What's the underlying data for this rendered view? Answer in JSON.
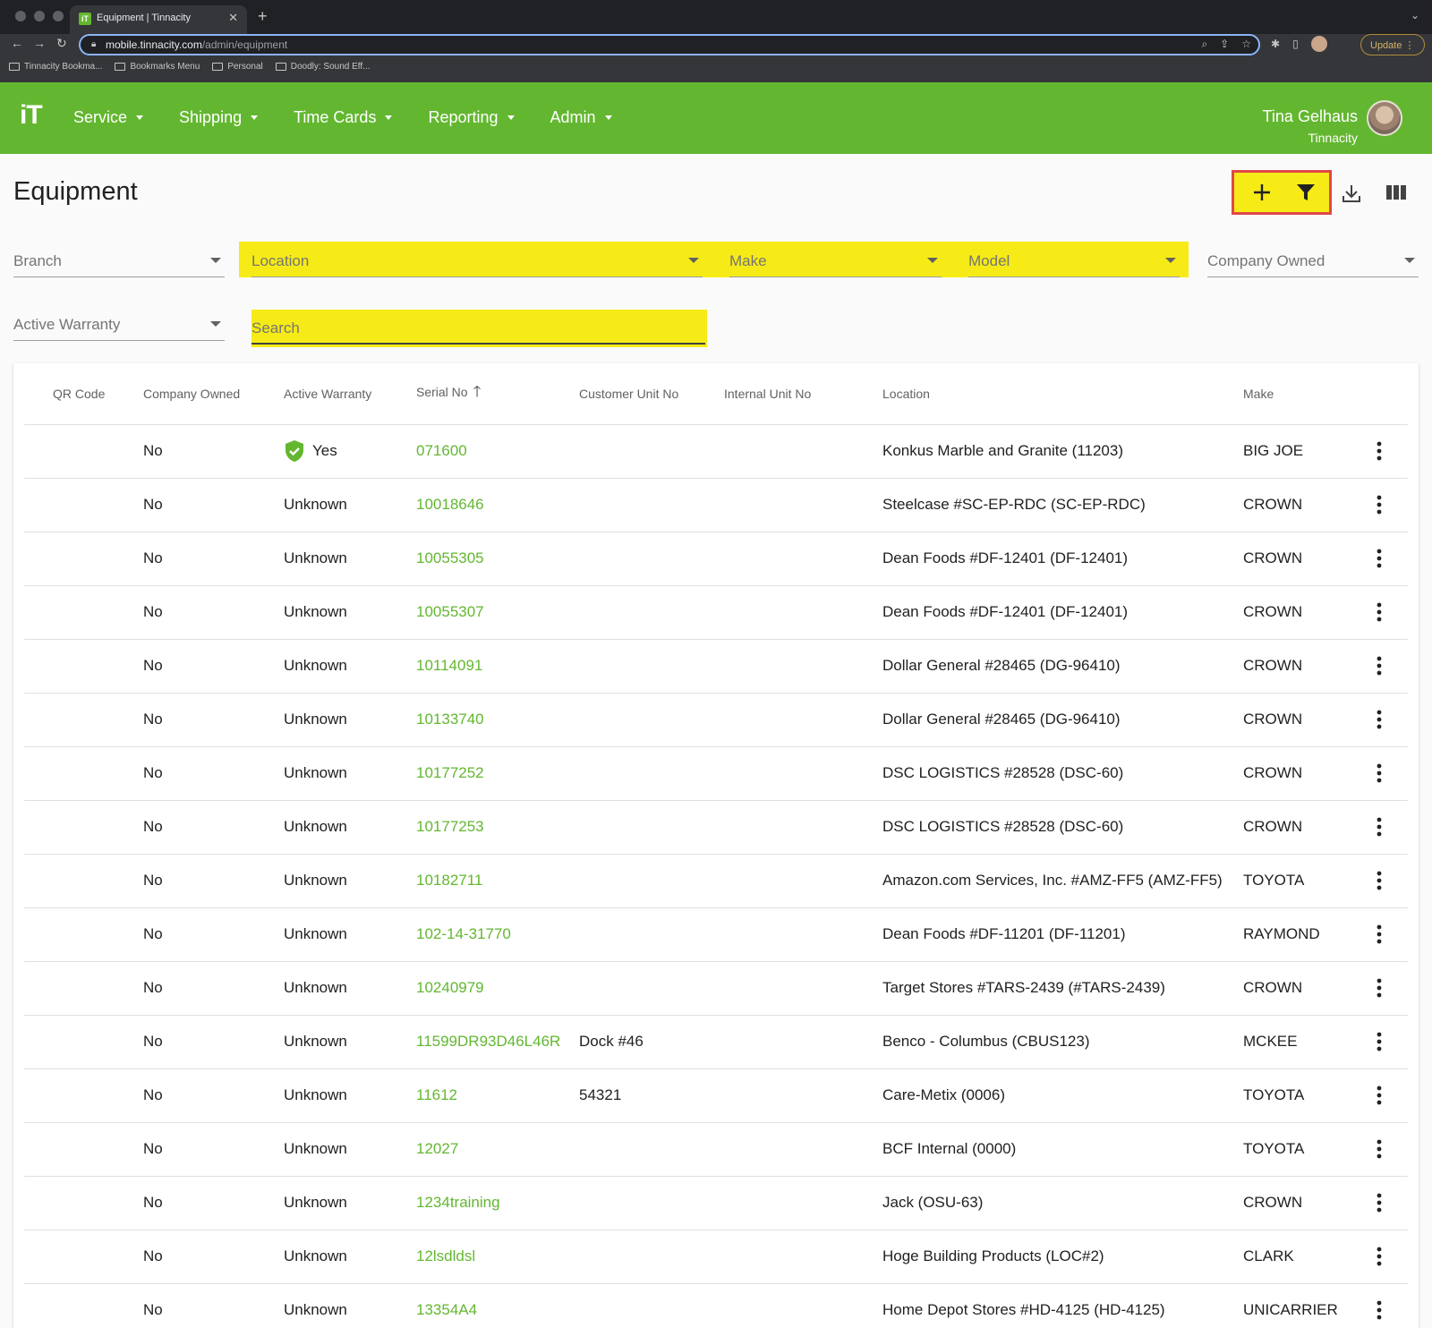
{
  "browser": {
    "tab_title": "Equipment | Tinnacity",
    "url_host": "mobile.tinnacity.com",
    "url_path": "/admin/equipment",
    "update_label": "Update",
    "bookmarks": [
      "Tinnacity Bookma...",
      "Bookmarks Menu",
      "Personal",
      "Doodly: Sound Eff..."
    ]
  },
  "appbar": {
    "logo": "iT",
    "menu": [
      "Service",
      "Shipping",
      "Time Cards",
      "Reporting",
      "Admin"
    ],
    "user_name": "Tina Gelhaus",
    "user_org": "Tinnacity"
  },
  "page": {
    "title": "Equipment"
  },
  "filters": {
    "branch": "Branch",
    "location": "Location",
    "make": "Make",
    "model": "Model",
    "company_owned": "Company Owned",
    "active_warranty": "Active Warranty",
    "search_placeholder": "Search"
  },
  "table": {
    "columns": [
      "QR Code",
      "Company Owned",
      "Active Warranty",
      "Serial No",
      "Customer Unit No",
      "Internal Unit No",
      "Location",
      "Make"
    ],
    "rows": [
      {
        "qr": "",
        "owned": "No",
        "warranty": "Yes",
        "serial": "071600",
        "cust": "",
        "internal": "",
        "location": "Konkus Marble and Granite (11203)",
        "make": "BIG JOE"
      },
      {
        "qr": "",
        "owned": "No",
        "warranty": "Unknown",
        "serial": "10018646",
        "cust": "",
        "internal": "",
        "location": "Steelcase #SC-EP-RDC (SC-EP-RDC)",
        "make": "CROWN"
      },
      {
        "qr": "",
        "owned": "No",
        "warranty": "Unknown",
        "serial": "10055305",
        "cust": "",
        "internal": "",
        "location": "Dean Foods #DF-12401 (DF-12401)",
        "make": "CROWN"
      },
      {
        "qr": "",
        "owned": "No",
        "warranty": "Unknown",
        "serial": "10055307",
        "cust": "",
        "internal": "",
        "location": "Dean Foods #DF-12401 (DF-12401)",
        "make": "CROWN"
      },
      {
        "qr": "",
        "owned": "No",
        "warranty": "Unknown",
        "serial": "10114091",
        "cust": "",
        "internal": "",
        "location": "Dollar General #28465 (DG-96410)",
        "make": "CROWN"
      },
      {
        "qr": "",
        "owned": "No",
        "warranty": "Unknown",
        "serial": "10133740",
        "cust": "",
        "internal": "",
        "location": "Dollar General #28465 (DG-96410)",
        "make": "CROWN"
      },
      {
        "qr": "",
        "owned": "No",
        "warranty": "Unknown",
        "serial": "10177252",
        "cust": "",
        "internal": "",
        "location": "DSC LOGISTICS #28528 (DSC-60)",
        "make": "CROWN"
      },
      {
        "qr": "",
        "owned": "No",
        "warranty": "Unknown",
        "serial": "10177253",
        "cust": "",
        "internal": "",
        "location": "DSC LOGISTICS #28528 (DSC-60)",
        "make": "CROWN"
      },
      {
        "qr": "",
        "owned": "No",
        "warranty": "Unknown",
        "serial": "10182711",
        "cust": "",
        "internal": "",
        "location": "Amazon.com Services, Inc. #AMZ-FF5 (AMZ-FF5)",
        "make": "TOYOTA"
      },
      {
        "qr": "",
        "owned": "No",
        "warranty": "Unknown",
        "serial": "102-14-31770",
        "cust": "",
        "internal": "",
        "location": "Dean Foods #DF-11201 (DF-11201)",
        "make": "RAYMOND"
      },
      {
        "qr": "",
        "owned": "No",
        "warranty": "Unknown",
        "serial": "10240979",
        "cust": "",
        "internal": "",
        "location": "Target Stores #TARS-2439 (#TARS-2439)",
        "make": "CROWN"
      },
      {
        "qr": "",
        "owned": "No",
        "warranty": "Unknown",
        "serial": "11599DR93D46L46R",
        "cust": "Dock #46",
        "internal": "",
        "location": "Benco - Columbus (CBUS123)",
        "make": "MCKEE"
      },
      {
        "qr": "",
        "owned": "No",
        "warranty": "Unknown",
        "serial": "11612",
        "cust": "54321",
        "internal": "",
        "location": "Care-Metix (0006)",
        "make": "TOYOTA"
      },
      {
        "qr": "",
        "owned": "No",
        "warranty": "Unknown",
        "serial": "12027",
        "cust": "",
        "internal": "",
        "location": "BCF Internal (0000)",
        "make": "TOYOTA"
      },
      {
        "qr": "",
        "owned": "No",
        "warranty": "Unknown",
        "serial": "1234training",
        "cust": "",
        "internal": "",
        "location": "Jack (OSU-63)",
        "make": "CROWN"
      },
      {
        "qr": "",
        "owned": "No",
        "warranty": "Unknown",
        "serial": "12lsdldsl",
        "cust": "",
        "internal": "",
        "location": "Hoge Building Products (LOC#2)",
        "make": "CLARK"
      },
      {
        "qr": "",
        "owned": "No",
        "warranty": "Unknown",
        "serial": "13354A4",
        "cust": "",
        "internal": "",
        "location": "Home Depot Stores #HD-4125 (HD-4125)",
        "make": "UNICARRIER"
      }
    ]
  },
  "colors": {
    "brand_green": "#63b730",
    "highlight_yellow": "#f6eb16",
    "callout_red": "#e04848"
  }
}
